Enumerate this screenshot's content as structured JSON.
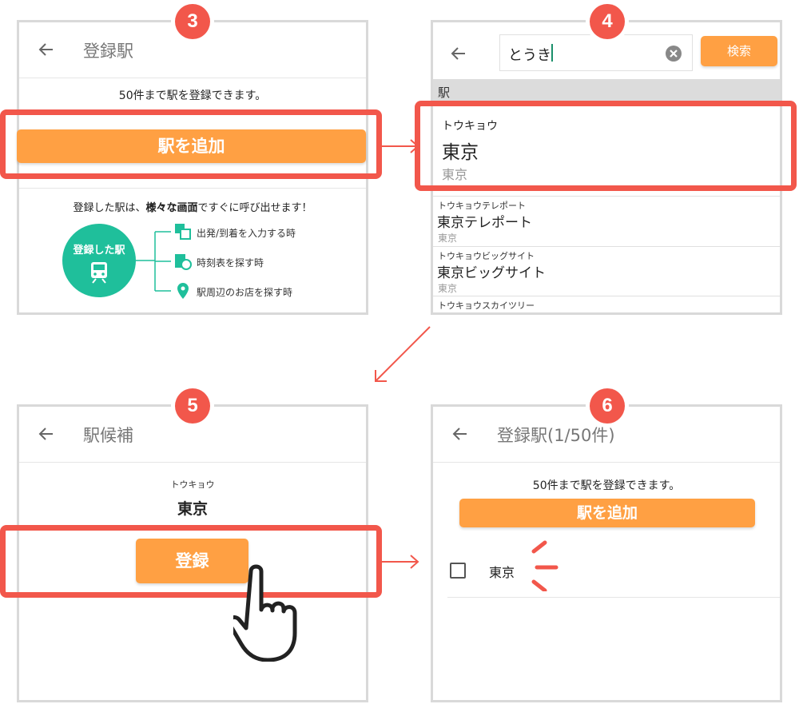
{
  "colors": {
    "accent": "#ffa043",
    "highlight": "#f2574b",
    "teal": "#1fbf9b",
    "border": "#d9d9d9"
  },
  "step3": {
    "badge": "3",
    "title": "登録駅",
    "note": "50件まで駅を登録できます。",
    "add_button": "駅を追加",
    "promo": {
      "text_pre": "登録した駅は、",
      "text_em": "様々な画面",
      "text_post": "ですぐに呼び出せます！",
      "circle_label": "登録した駅",
      "items": [
        {
          "icon": "route-icon",
          "label": "出発/到着を入力する時"
        },
        {
          "icon": "timetable-icon",
          "label": "時刻表を探す時"
        },
        {
          "icon": "map-pin-icon",
          "label": "駅周辺のお店を探す時"
        }
      ]
    }
  },
  "step4": {
    "badge": "4",
    "search_value": "とうき",
    "search_button": "検索",
    "section_label": "駅",
    "results": [
      {
        "kana": "トウキョウ",
        "name": "東京",
        "sub": "東京"
      },
      {
        "kana": "トウキョウテレポート",
        "name": "東京テレポート",
        "sub": "東京"
      },
      {
        "kana": "トウキョウビッグサイト",
        "name": "東京ビッグサイト",
        "sub": "東京"
      },
      {
        "kana": "トウキョウスカイツリー",
        "name": "",
        "sub": ""
      }
    ]
  },
  "step5": {
    "badge": "5",
    "title": "駅候補",
    "kana": "トウキョウ",
    "name": "東京",
    "register_button": "登録"
  },
  "step6": {
    "badge": "6",
    "title": "登録駅(1/50件)",
    "note": "50件まで駅を登録できます。",
    "add_button": "駅を追加",
    "item": "東京"
  }
}
